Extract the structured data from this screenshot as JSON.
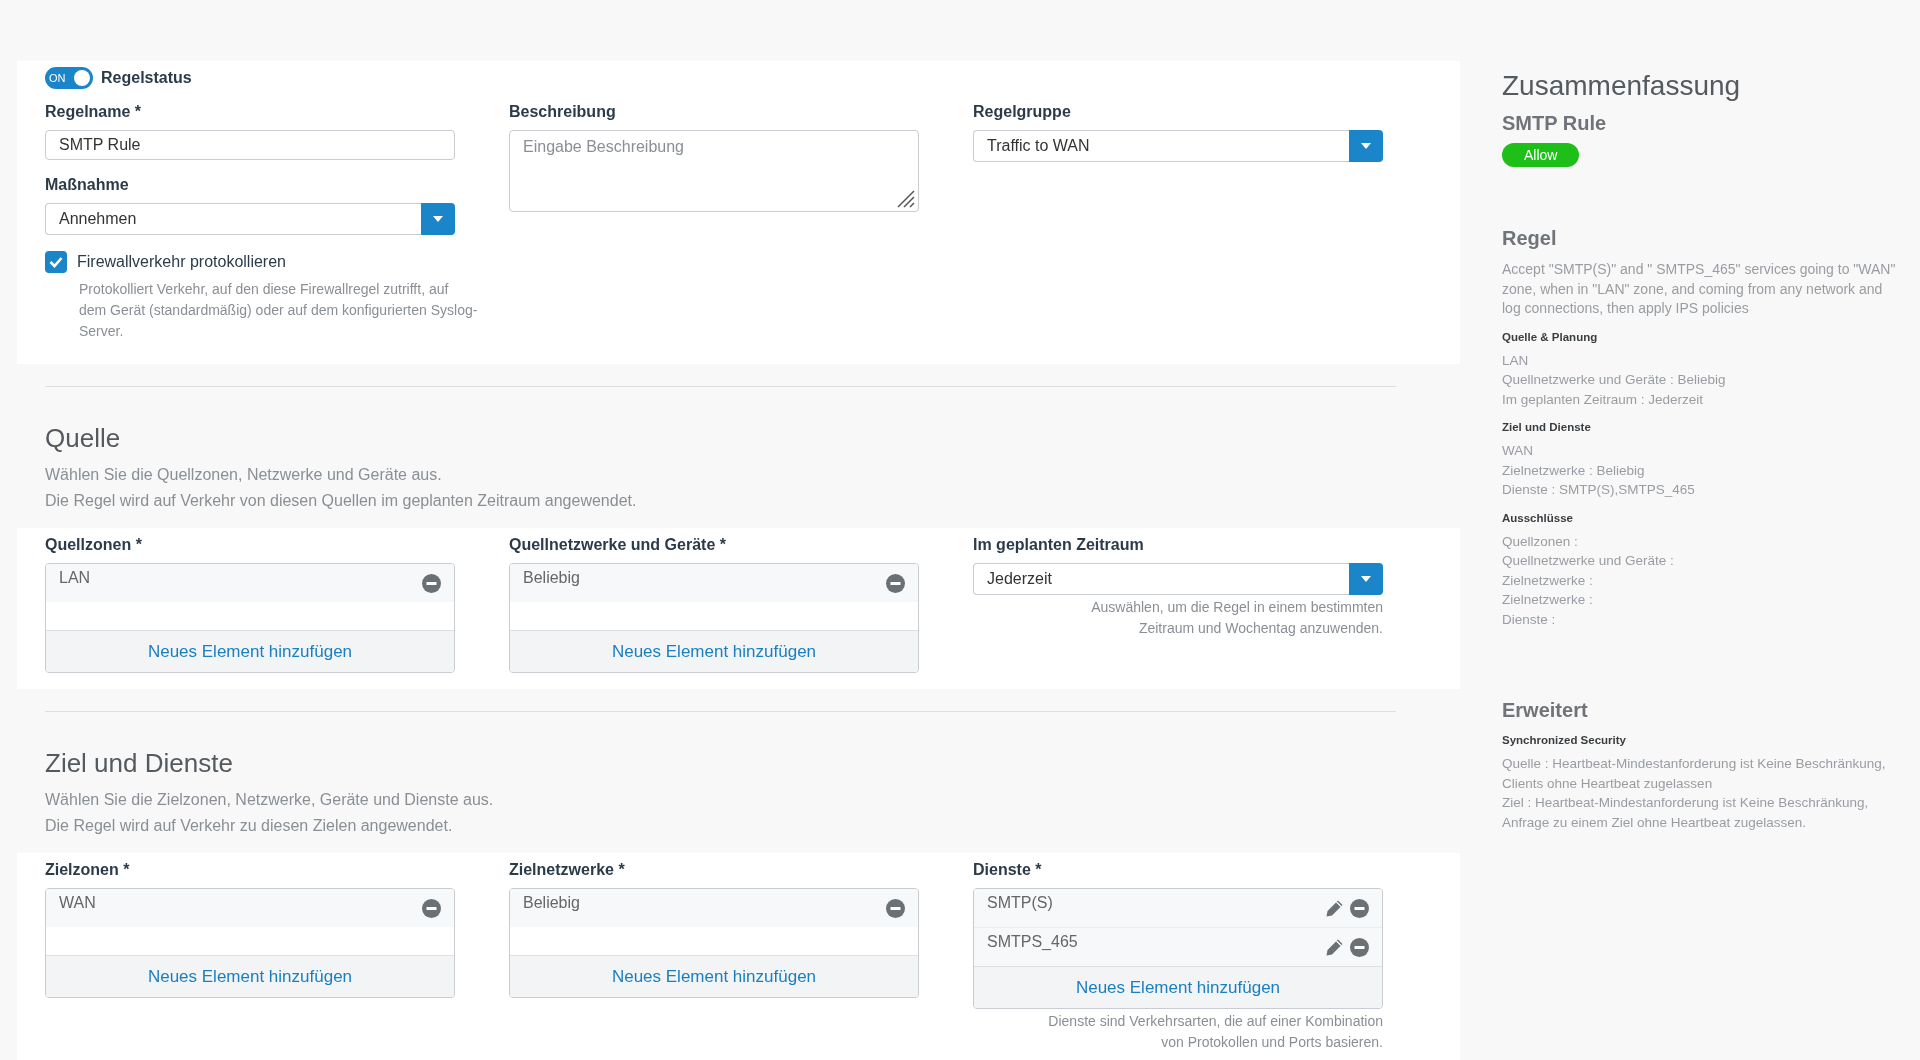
{
  "general": {
    "status": {
      "toggle_text": "ON",
      "on": true,
      "label": "Regelstatus"
    },
    "rule_name": {
      "label": "Regelname *",
      "value": "SMTP Rule"
    },
    "action": {
      "label": "Maßnahme",
      "value": "Annehmen"
    },
    "log_traffic": {
      "label": "Firewallverkehr protokollieren",
      "checked": true,
      "help": "Protokolliert Verkehr, auf den diese Firewallregel zutrifft, auf dem Gerät (standardmäßig) oder auf dem konfigurierten Syslog-Server."
    },
    "description": {
      "label": "Beschreibung",
      "placeholder": "Eingabe Beschreibung"
    },
    "rule_group": {
      "label": "Regelgruppe",
      "value": "Traffic to WAN"
    }
  },
  "sections": [
    {
      "title": "Quelle",
      "description": [
        "Wählen Sie die Quellzonen, Netzwerke und Geräte aus.",
        "Die Regel wird auf Verkehr von diesen Quellen im geplanten Zeitraum angewendet."
      ],
      "fields": [
        {
          "kind": "list",
          "label": "Quellzonen *",
          "items": [
            {
              "text": "LAN",
              "editable": false
            }
          ],
          "add_button": "Neues Element hinzufügen"
        },
        {
          "kind": "list",
          "label": "Quellnetzwerke und Geräte *",
          "items": [
            {
              "text": "Beliebig",
              "editable": false
            }
          ],
          "add_button": "Neues Element hinzufügen"
        },
        {
          "kind": "select",
          "label": "Im geplanten Zeitraum",
          "value": "Jederzeit",
          "help": "Auswählen, um die Regel in einem bestimmten Zeitraum und Wochentag anzuwenden."
        }
      ]
    },
    {
      "title": "Ziel und Dienste",
      "description": [
        "Wählen Sie die Zielzonen, Netzwerke, Geräte und Dienste aus.",
        "Die Regel wird auf Verkehr zu diesen Zielen angewendet."
      ],
      "fields": [
        {
          "kind": "list",
          "label": "Zielzonen *",
          "items": [
            {
              "text": "WAN",
              "editable": false
            }
          ],
          "add_button": "Neues Element hinzufügen"
        },
        {
          "kind": "list",
          "label": "Zielnetzwerke *",
          "items": [
            {
              "text": "Beliebig",
              "editable": false
            }
          ],
          "add_button": "Neues Element hinzufügen"
        },
        {
          "kind": "list",
          "label": "Dienste *",
          "items": [
            {
              "text": "SMTP(S)",
              "editable": true
            },
            {
              "text": "SMTPS_465",
              "editable": true
            }
          ],
          "add_button": "Neues Element hinzufügen",
          "help": "Dienste sind Verkehrsarten, die auf einer Kombination von Protokollen und Ports basieren."
        }
      ]
    }
  ],
  "summary": {
    "title": "Zusammenfassung",
    "rule_name": "SMTP Rule",
    "badge": "Allow",
    "sections": [
      {
        "title": "Regel",
        "text": "Accept \"SMTP(S)\" and \" SMTPS_465\" services going to \"WAN\" zone, when in \"LAN\" zone, and coming from any network and log connections, then apply IPS policies",
        "groups": [
          {
            "title": "Quelle & Planung",
            "lines": [
              "LAN",
              "Quellnetzwerke und Geräte : Beliebig",
              "Im geplanten Zeitraum : Jederzeit"
            ]
          },
          {
            "title": "Ziel und Dienste",
            "lines": [
              "WAN",
              "Zielnetzwerke : Beliebig",
              "Dienste : SMTP(S),SMTPS_465"
            ]
          },
          {
            "title": "Ausschlüsse",
            "lines": [
              "Quellzonen :",
              "Quellnetzwerke und Geräte :",
              "Zielnetzwerke :",
              "Zielnetzwerke :",
              "Dienste :"
            ]
          }
        ]
      },
      {
        "title": "Erweitert",
        "groups": [
          {
            "title": "Synchronized Security",
            "lines": [
              "Quelle : Heartbeat-Mindestanforderung ist Keine Beschränkung, Clients ohne Heartbeat zugelassen",
              "Ziel : Heartbeat-Mindestanforderung ist Keine Beschränkung, Anfrage zu einem Ziel ohne Heartbeat zugelassen."
            ]
          }
        ]
      }
    ]
  }
}
